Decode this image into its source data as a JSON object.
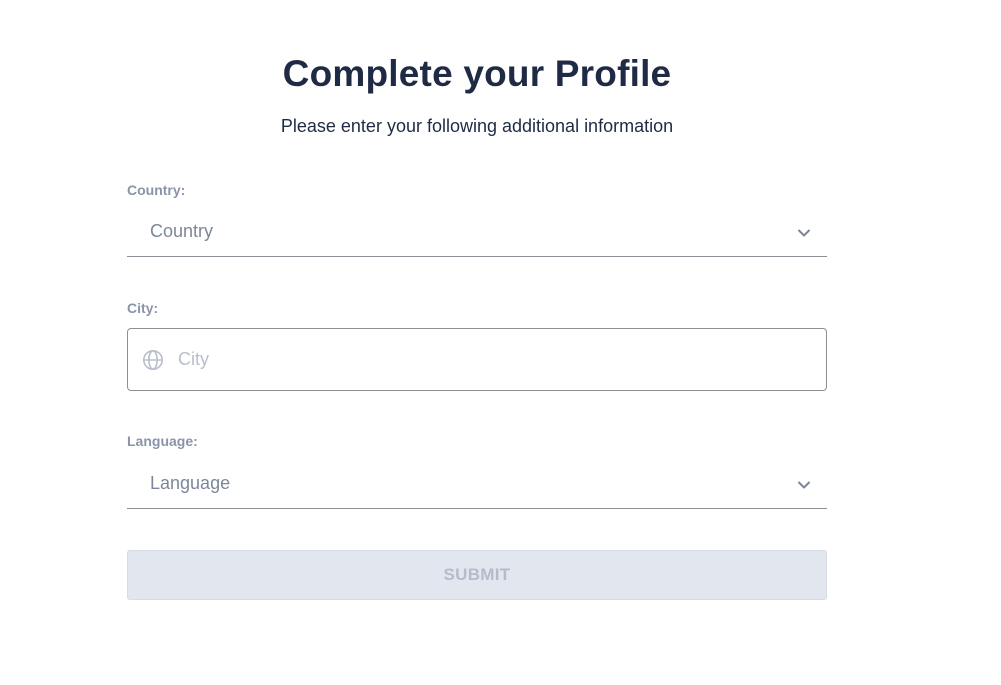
{
  "header": {
    "title": "Complete your Profile",
    "subtitle": "Please enter your following additional information"
  },
  "form": {
    "country": {
      "label": "Country:",
      "selected": "Country"
    },
    "city": {
      "label": "City:",
      "placeholder": "City",
      "value": ""
    },
    "language": {
      "label": "Language:",
      "selected": "Language"
    },
    "submit_label": "SUBMIT",
    "submit_disabled": true
  },
  "icons": {
    "select_indicator": "chevron-down-icon",
    "city_prefix": "globe-icon"
  },
  "colors": {
    "heading": "#1f2a44",
    "label": "#8a94a8",
    "button_disabled_bg": "#e2e6ee",
    "button_disabled_text": "#b4bccb"
  }
}
